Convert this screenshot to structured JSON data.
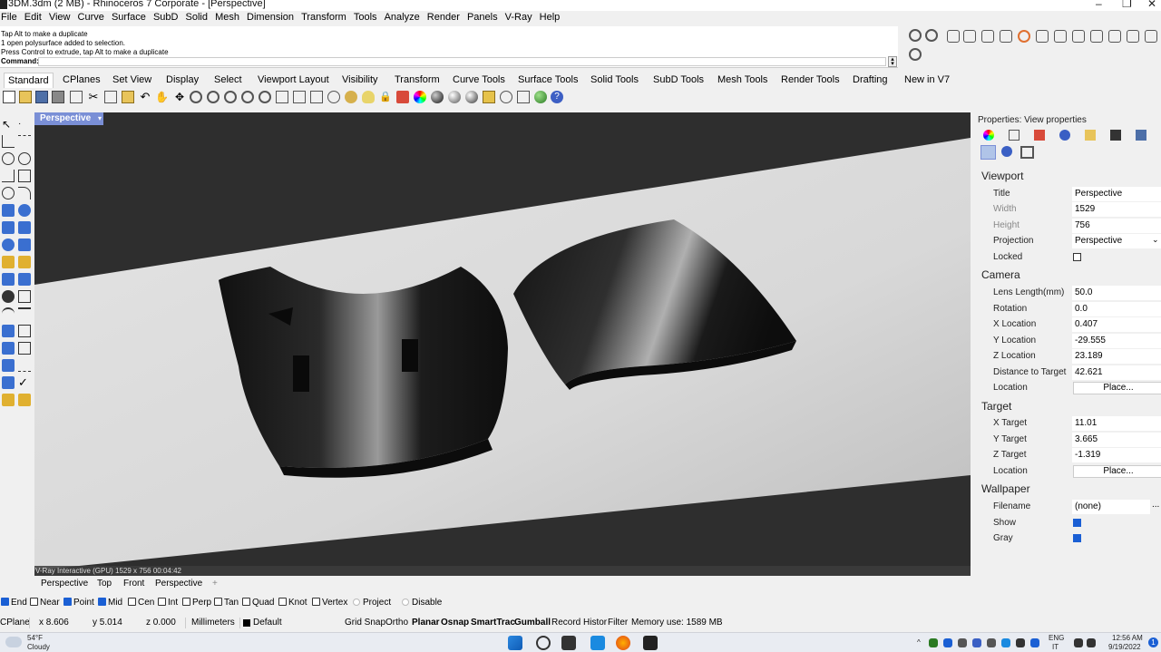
{
  "window": {
    "title": "3DM.3dm (2 MB) - Rhinoceros 7 Corporate - [Perspective]",
    "controls": [
      "–",
      "❐",
      "✕"
    ]
  },
  "menu": [
    "File",
    "Edit",
    "View",
    "Curve",
    "Surface",
    "SubD",
    "Solid",
    "Mesh",
    "Dimension",
    "Transform",
    "Tools",
    "Analyze",
    "Render",
    "Panels",
    "V-Ray",
    "Help"
  ],
  "command_history": [
    "Tap Alt to make a duplicate",
    "1 open polysurface added to selection.",
    "Press Control to extrude, tap Alt to make a duplicate"
  ],
  "command_prompt": "Command:",
  "tabs": [
    "Standard",
    "CPlanes",
    "Set View",
    "Display",
    "Select",
    "Viewport Layout",
    "Visibility",
    "Transform",
    "Curve Tools",
    "Surface Tools",
    "Solid Tools",
    "SubD Tools",
    "Mesh Tools",
    "Render Tools",
    "Drafting",
    "New in V7"
  ],
  "active_tab": "Standard",
  "viewport": {
    "label": "Perspective",
    "render_status": "V-Ray Interactive (GPU)   1529 x 756    00:04:42"
  },
  "viewport_tabs": [
    "Perspective",
    "Top",
    "Front",
    "Perspective",
    "+"
  ],
  "osnap": [
    {
      "label": "End",
      "checked": true
    },
    {
      "label": "Near",
      "checked": false
    },
    {
      "label": "Point",
      "checked": true
    },
    {
      "label": "Mid",
      "checked": true
    },
    {
      "label": "Cen",
      "checked": false
    },
    {
      "label": "Int",
      "checked": false
    },
    {
      "label": "Perp",
      "checked": false
    },
    {
      "label": "Tan",
      "checked": false
    },
    {
      "label": "Quad",
      "checked": false
    },
    {
      "label": "Knot",
      "checked": false
    },
    {
      "label": "Vertex",
      "checked": false
    }
  ],
  "osnap_extra": [
    "Project",
    "Disable"
  ],
  "status": {
    "cplane": "CPlane",
    "x": "x 8.606",
    "y": "y 5.014",
    "z": "z 0.000",
    "units": "Millimeters",
    "layer": "Default",
    "grid_snap": "Grid Snap",
    "ortho": "Ortho",
    "planar": "Planar",
    "osnap": "Osnap",
    "smarttrack": "SmartTrac",
    "gumball": "Gumball",
    "record": "Record Histor",
    "filter": "Filter",
    "memory": "Memory use: 1589 MB"
  },
  "properties": {
    "title": "Properties: View properties",
    "sections": {
      "viewport": "Viewport",
      "camera": "Camera",
      "target": "Target",
      "wallpaper": "Wallpaper"
    },
    "viewport_rows": [
      {
        "label": "Title",
        "value": "Perspective"
      },
      {
        "label": "Width",
        "value": "1529"
      },
      {
        "label": "Height",
        "value": "756"
      },
      {
        "label": "Projection",
        "value": "Perspective"
      }
    ],
    "locked_label": "Locked",
    "camera_rows": [
      {
        "label": "Lens Length(mm)",
        "value": "50.0"
      },
      {
        "label": "Rotation",
        "value": "0.0"
      },
      {
        "label": "X Location",
        "value": "0.407"
      },
      {
        "label": "Y Location",
        "value": "-29.555"
      },
      {
        "label": "Z Location",
        "value": "23.189"
      },
      {
        "label": "Distance to Target",
        "value": "42.621"
      }
    ],
    "location_label": "Location",
    "place_button": "Place...",
    "target_rows": [
      {
        "label": "X Target",
        "value": "11.01"
      },
      {
        "label": "Y Target",
        "value": "3.665"
      },
      {
        "label": "Z Target",
        "value": "-1.319"
      }
    ],
    "wallpaper_rows": {
      "filename_label": "Filename",
      "filename_value": "(none)",
      "show_label": "Show",
      "gray_label": "Gray"
    }
  },
  "taskbar": {
    "weather_temp": "54°F",
    "weather_desc": "Cloudy",
    "lang": "ENG",
    "region": "IT",
    "time": "12:56 AM",
    "date": "9/19/2022",
    "notifications": "1"
  },
  "colors": {
    "accent": "#1a5fd4",
    "viewport_label": "#7a8fd6"
  }
}
